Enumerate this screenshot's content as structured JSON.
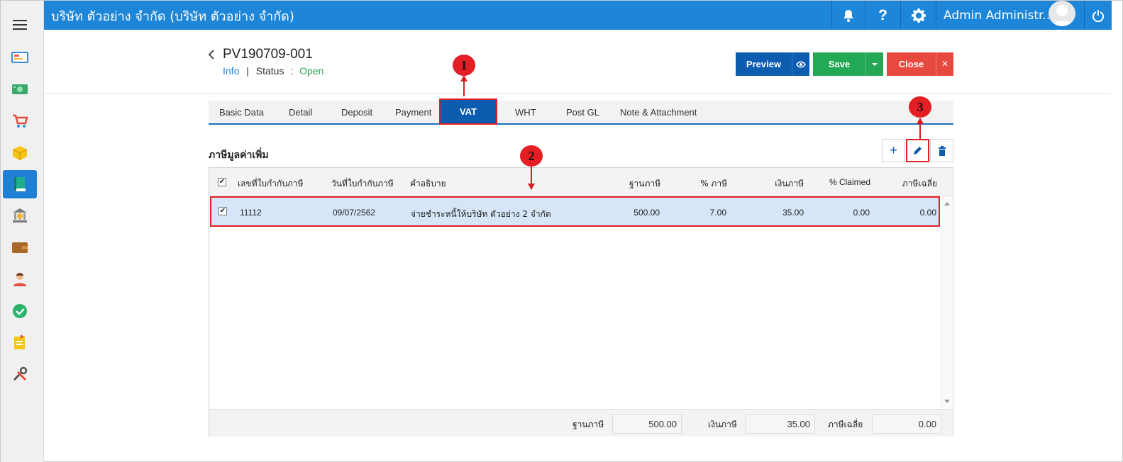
{
  "topbar": {
    "company": "บริษัท ตัวอย่าง จำกัด (บริษัท ตัวอย่าง จำกัด)",
    "help": "?",
    "user_name": "Admin Administr...",
    "color": "#1e86d8"
  },
  "sidebar": {
    "items": [
      "menu-icon",
      "dashboard-icon",
      "money-icon",
      "cart-icon",
      "box-icon",
      "book-icon",
      "bank-icon",
      "wallet-icon",
      "user-icon",
      "check-icon",
      "report-icon",
      "tools-icon"
    ],
    "active": "book-icon"
  },
  "document": {
    "number": "PV190709-001",
    "info_label": "Info",
    "separator": "|",
    "status_label": "Status",
    "status_colon": ":",
    "status_value": "Open"
  },
  "actions": {
    "preview": "Preview",
    "save": "Save",
    "close": "Close",
    "close_x": "×"
  },
  "tabs": [
    "Basic Data",
    "Detail",
    "Deposit",
    "Payment",
    "VAT",
    "WHT",
    "Post GL",
    "Note & Attachment"
  ],
  "active_tab": "VAT",
  "section": {
    "title": "ภาษีมูลค่าเพิ่ม",
    "add": "+"
  },
  "grid": {
    "columns": [
      "เลขที่ใบกำกับภาษี",
      "วันที่ใบกำกับภาษี",
      "คำอธิบาย",
      "ฐานภาษี",
      "% ภาษี",
      "เงินภาษี",
      "% Claimed",
      "ภาษีเฉลี่ย"
    ],
    "rows": [
      {
        "invoice_no": "11112",
        "invoice_date": "09/07/2562",
        "description": "จ่ายชำระหนี้ให้บริษัท ตัวอย่าง 2 จำกัด",
        "tax_base": "500.00",
        "tax_pct": "7.00",
        "tax_amount": "35.00",
        "claimed_pct": "0.00",
        "avg_tax": "0.00"
      }
    ],
    "checkmark": "✔"
  },
  "footer": {
    "tax_base_label": "ฐานภาษี",
    "tax_base_value": "500.00",
    "tax_amount_label": "เงินภาษี",
    "tax_amount_value": "35.00",
    "avg_tax_label": "ภาษีเฉลี่ย",
    "avg_tax_value": "0.00"
  },
  "markers": [
    "1",
    "2",
    "3"
  ]
}
